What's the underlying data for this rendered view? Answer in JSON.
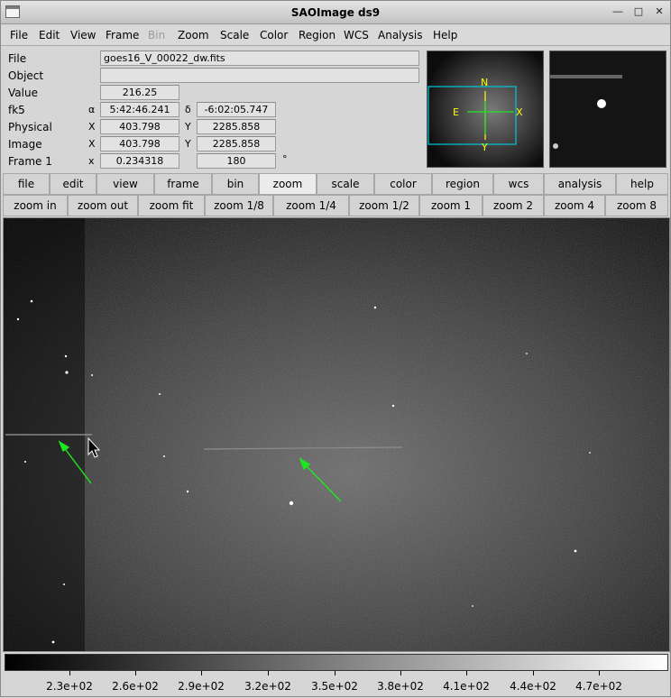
{
  "window": {
    "title": "SAOImage ds9"
  },
  "menubar": {
    "items": [
      {
        "label": "File",
        "disabled": false
      },
      {
        "label": "Edit",
        "disabled": false
      },
      {
        "label": "View",
        "disabled": false
      },
      {
        "label": "Frame",
        "disabled": false
      },
      {
        "label": "Bin",
        "disabled": true
      },
      {
        "label": "Zoom",
        "disabled": false
      },
      {
        "label": "Scale",
        "disabled": false
      },
      {
        "label": "Color",
        "disabled": false
      },
      {
        "label": "Region",
        "disabled": false
      },
      {
        "label": "WCS",
        "disabled": false
      },
      {
        "label": "Analysis",
        "disabled": false
      },
      {
        "label": "Help",
        "disabled": false
      }
    ]
  },
  "info": {
    "file_label": "File",
    "file_value": "goes16_V_00022_dw.fits",
    "object_label": "Object",
    "object_value": "",
    "value_label": "Value",
    "value_value": "216.25",
    "fk5_label": "fk5",
    "fk5_alpha_sym": "α",
    "fk5_alpha": "5:42:46.241",
    "fk5_delta_sym": "δ",
    "fk5_delta": "-6:02:05.747",
    "physical_label": "Physical",
    "physical_x_sym": "X",
    "physical_x": "403.798",
    "physical_y_sym": "Y",
    "physical_y": "2285.858",
    "image_label": "Image",
    "image_x_sym": "X",
    "image_x": "403.798",
    "image_y_sym": "Y",
    "image_y": "2285.858",
    "frame_label": "Frame 1",
    "frame_x_sym": "x",
    "frame_zoom": "0.234318",
    "frame_angle": "180",
    "frame_deg": "°"
  },
  "panner": {
    "n": "N",
    "e": "E",
    "x": "X",
    "y": "Y"
  },
  "buttons_main": [
    {
      "label": "file",
      "active": false
    },
    {
      "label": "edit",
      "active": false
    },
    {
      "label": "view",
      "active": false
    },
    {
      "label": "frame",
      "active": false
    },
    {
      "label": "bin",
      "active": false
    },
    {
      "label": "zoom",
      "active": true
    },
    {
      "label": "scale",
      "active": false
    },
    {
      "label": "color",
      "active": false
    },
    {
      "label": "region",
      "active": false
    },
    {
      "label": "wcs",
      "active": false
    },
    {
      "label": "analysis",
      "active": false
    },
    {
      "label": "help",
      "active": false
    }
  ],
  "buttons_zoom": [
    {
      "label": "zoom in"
    },
    {
      "label": "zoom out"
    },
    {
      "label": "zoom fit"
    },
    {
      "label": "zoom 1/8"
    },
    {
      "label": "zoom 1/4"
    },
    {
      "label": "zoom 1/2"
    },
    {
      "label": "zoom 1"
    },
    {
      "label": "zoom 2"
    },
    {
      "label": "zoom 4"
    },
    {
      "label": "zoom 8"
    }
  ],
  "colorbar": {
    "ticks": [
      "2.3e+02",
      "2.6e+02",
      "2.9e+02",
      "3.2e+02",
      "3.5e+02",
      "3.8e+02",
      "4.1e+02",
      "4.4e+02",
      "4.7e+02"
    ]
  },
  "colors": {
    "arrow": "#1ee81e",
    "compass": "#ffff00",
    "panner_box": "#00c8d8"
  }
}
